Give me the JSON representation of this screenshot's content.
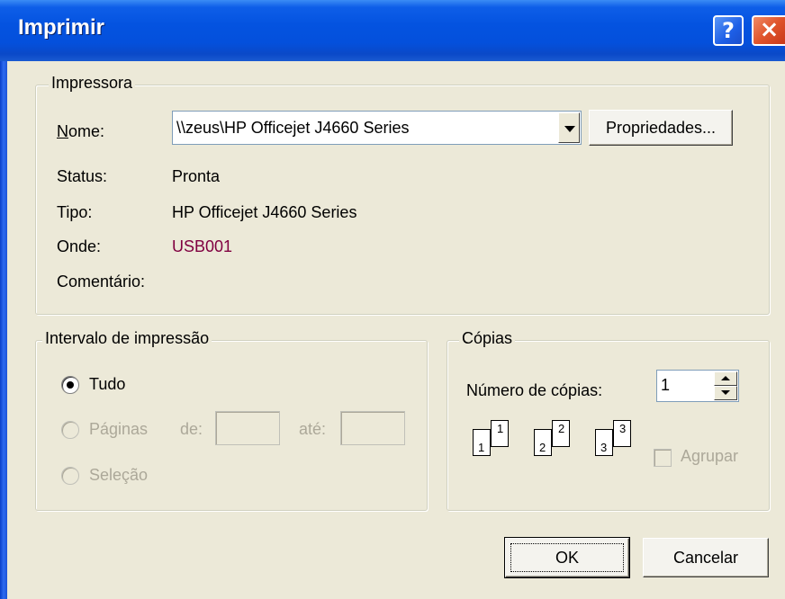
{
  "window": {
    "title": "Imprimir",
    "help_label": "?",
    "close_label": "×"
  },
  "printer": {
    "legend": "Impressora",
    "name_label": "Nome:",
    "name_value": "\\\\zeus\\HP Officejet J4660 Series",
    "properties_label": "Propriedades...",
    "status_label": "Status:",
    "status_value": "Pronta",
    "type_label": "Tipo:",
    "type_value": "HP Officejet J4660 Series",
    "where_label": "Onde:",
    "where_value": "USB001",
    "comment_label": "Comentário:"
  },
  "range": {
    "legend": "Intervalo de impressão",
    "all_label": "Tudo",
    "pages_label": "Páginas",
    "from_label": "de:",
    "to_label": "até:",
    "selection_label": "Seleção",
    "selected": "all"
  },
  "copies": {
    "legend": "Cópias",
    "count_label": "Número de cópias:",
    "count_value": "1",
    "collate_label": "Agrupar",
    "collate_checked": false,
    "page_numbers": [
      "1",
      "1",
      "2",
      "2",
      "3",
      "3"
    ]
  },
  "buttons": {
    "ok_label": "OK",
    "cancel_label": "Cancelar"
  },
  "colors": {
    "where_value": "#800040",
    "disabled_text": "#aca899"
  }
}
